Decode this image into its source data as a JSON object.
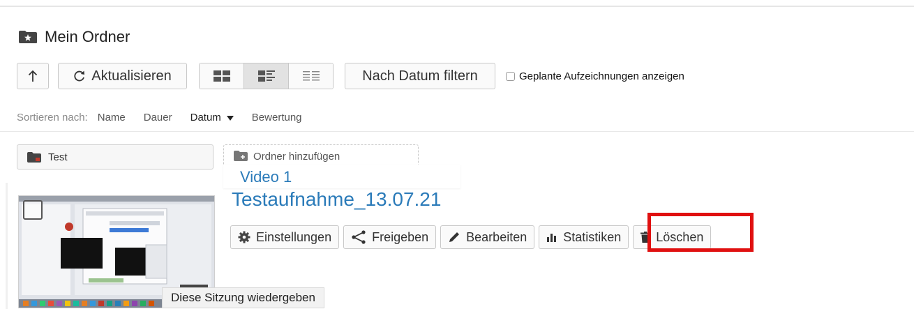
{
  "header": {
    "title": "Mein Ordner"
  },
  "toolbar": {
    "refresh_label": "Aktualisieren",
    "filter_label": "Nach Datum filtern",
    "scheduled_label": "Geplante Aufzeichnungen anzeigen",
    "view_modes": [
      "grid",
      "detail",
      "list"
    ],
    "active_view": "detail"
  },
  "sort": {
    "label": "Sortieren nach:",
    "options": [
      "Name",
      "Dauer",
      "Datum",
      "Bewertung"
    ],
    "active": "Datum"
  },
  "folders": {
    "items": [
      {
        "name": "Test",
        "icon": "folder-red-icon"
      }
    ],
    "add_label": "Ordner hinzufügen"
  },
  "video_tab": {
    "label": "Video 1"
  },
  "recording": {
    "title": "Testaufnahme_13.07.21",
    "actions": {
      "settings": "Einstellungen",
      "share": "Freigeben",
      "edit": "Bearbeiten",
      "stats": "Statistiken",
      "delete": "Löschen"
    }
  },
  "tooltip": {
    "text": "Diese Sitzung wiedergeben"
  },
  "colors": {
    "link": "#2b7bb9",
    "highlight": "#e01010",
    "folder_accent": "#c0392b"
  }
}
